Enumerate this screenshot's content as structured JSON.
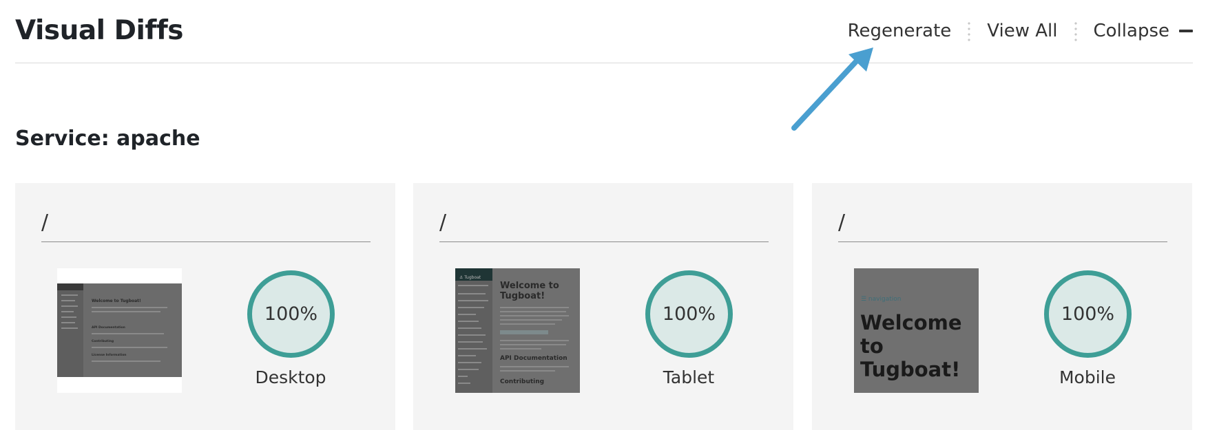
{
  "page": {
    "title": "Visual Diffs"
  },
  "actions": {
    "regenerate": "Regenerate",
    "view_all": "View All",
    "collapse": "Collapse"
  },
  "service": {
    "title": "Service: apache"
  },
  "cards": [
    {
      "path": "/",
      "percent": "100%",
      "device": "Desktop"
    },
    {
      "path": "/",
      "percent": "100%",
      "device": "Tablet"
    },
    {
      "path": "/",
      "percent": "100%",
      "device": "Mobile"
    }
  ],
  "thumbs": {
    "desktop": {
      "title": "Welcome to Tugboat!",
      "h1": "API Documentation",
      "h2": "Contributing",
      "h3": "License Information"
    },
    "tablet": {
      "brand": "⚓ Tugboat",
      "title_line1": "Welcome to",
      "title_line2": "Tugboat!",
      "h1": "API Documentation",
      "h2": "Contributing"
    },
    "mobile": {
      "nav": "☰ navigation",
      "title_line1": "Welcome",
      "title_line2": "to",
      "title_line3": "Tugboat!"
    }
  },
  "colors": {
    "gauge_ring": "#3e9e96",
    "gauge_fill": "#dbe9e7",
    "arrow": "#4a9fd0"
  },
  "icons": {
    "collapse": "minus-icon",
    "annotation": "arrow-icon"
  }
}
